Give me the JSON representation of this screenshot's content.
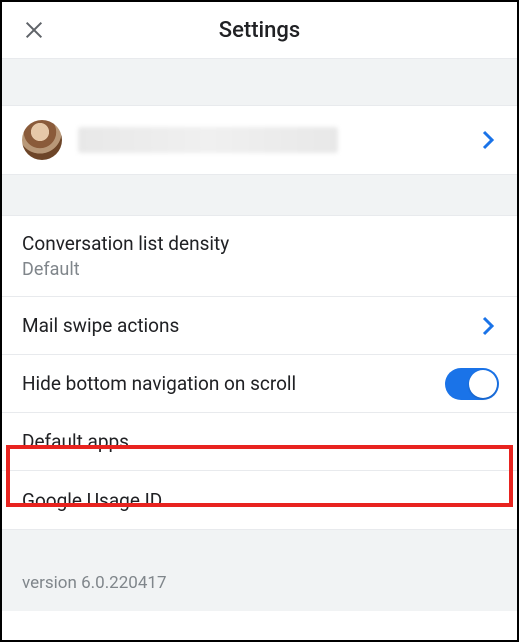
{
  "header": {
    "title": "Settings"
  },
  "account": {
    "name_redacted": ""
  },
  "rows": {
    "density": {
      "title": "Conversation list density",
      "value": "Default"
    },
    "swipe": {
      "title": "Mail swipe actions"
    },
    "hidenav": {
      "title": "Hide bottom navigation on scroll",
      "toggle_on": true
    },
    "defaultapps": {
      "title": "Default apps"
    },
    "usageid": {
      "title": "Google Usage ID"
    }
  },
  "footer": {
    "version": "version 6.0.220417"
  }
}
